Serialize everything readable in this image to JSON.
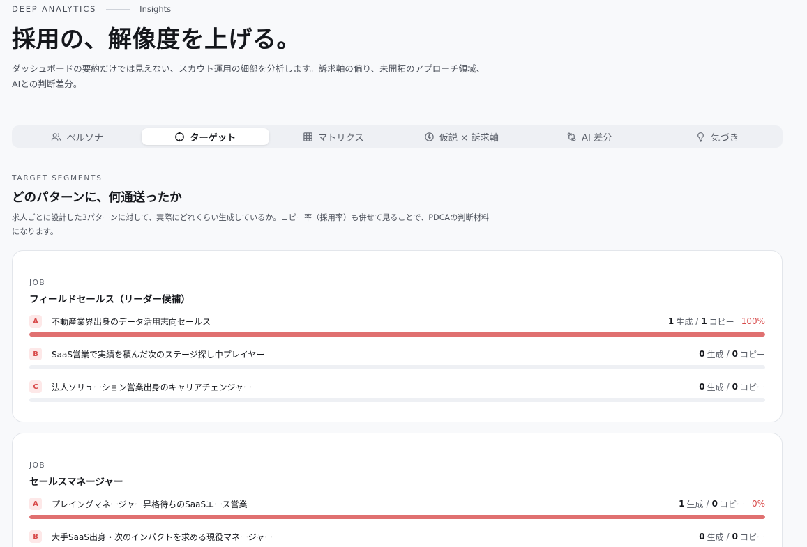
{
  "header": {
    "brand": "DEEP ANALYTICS",
    "crumb": "Insights",
    "title": "採用の、解像度を上げる。",
    "description": "ダッシュボードの要約だけでは見えない、スカウト運用の細部を分析します。訴求軸の偏り、未開拓のアプローチ領域、AIとの判断差分。"
  },
  "tabs": [
    {
      "label": "ペルソナ",
      "icon": "users-icon",
      "active": false
    },
    {
      "label": "ターゲット",
      "icon": "crosshair-icon",
      "active": true
    },
    {
      "label": "マトリクス",
      "icon": "grid-icon",
      "active": false
    },
    {
      "label": "仮説 × 訴求軸",
      "icon": "compass-icon",
      "active": false
    },
    {
      "label": "AI 差分",
      "icon": "diff-icon",
      "active": false
    },
    {
      "label": "気づき",
      "icon": "lightbulb-icon",
      "active": false
    }
  ],
  "section": {
    "eyebrow": "TARGET SEGMENTS",
    "title": "どのパターンに、何通送ったか",
    "description": "求人ごとに設計した3パターンに対して、実際にどれくらい生成しているか。コピー率（採用率）も併せて見ることで、PDCAの判断材料になります。"
  },
  "jobs": [
    {
      "eyebrow": "JOB",
      "title": "フィールドセールス（リーダー候補）",
      "patterns": [
        {
          "badge": "A",
          "label": "不動産業界出身のデータ活用志向セールス",
          "generated": "1",
          "generated_label": "生成",
          "copied": "1",
          "copied_label": "コピー",
          "rate": "100%",
          "fill": 1.0
        },
        {
          "badge": "B",
          "label": "SaaS営業で実績を積んだ次のステージ探し中プレイヤー",
          "generated": "0",
          "generated_label": "生成",
          "copied": "0",
          "copied_label": "コピー",
          "rate": "",
          "fill": 0
        },
        {
          "badge": "C",
          "label": "法人ソリューション営業出身のキャリアチェンジャー",
          "generated": "0",
          "generated_label": "生成",
          "copied": "0",
          "copied_label": "コピー",
          "rate": "",
          "fill": 0
        }
      ]
    },
    {
      "eyebrow": "JOB",
      "title": "セールスマネージャー",
      "patterns": [
        {
          "badge": "A",
          "label": "プレイングマネージャー昇格待ちのSaaSエース営業",
          "generated": "1",
          "generated_label": "生成",
          "copied": "0",
          "copied_label": "コピー",
          "rate": "0%",
          "fill": 1.0
        },
        {
          "badge": "B",
          "label": "大手SaaS出身・次のインパクトを求める現役マネージャー",
          "generated": "0",
          "generated_label": "生成",
          "copied": "0",
          "copied_label": "コピー",
          "rate": "",
          "fill": 0
        }
      ]
    }
  ],
  "colors": {
    "accent": "#e07070",
    "badge_text": "#d84a4a",
    "badge_bg": "#fde8e8"
  }
}
